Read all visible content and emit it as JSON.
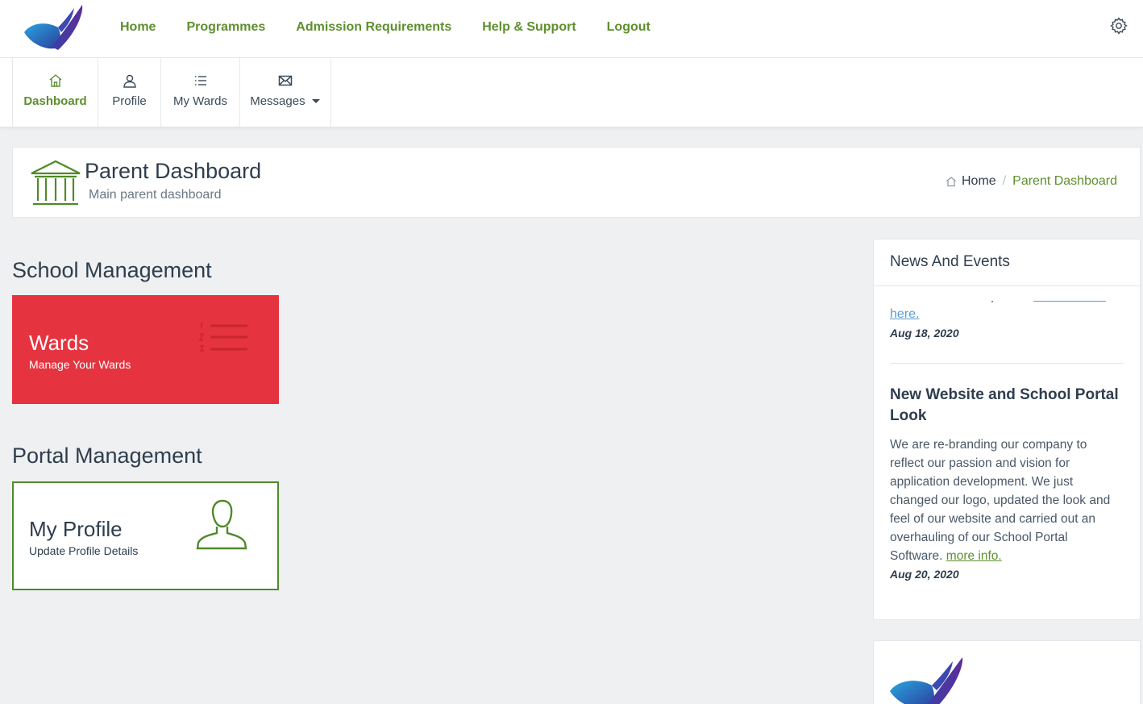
{
  "topnav": {
    "items": [
      "Home",
      "Programmes",
      "Admission Requirements",
      "Help & Support",
      "Logout"
    ]
  },
  "subnav": {
    "tabs": [
      {
        "label": "Dashboard",
        "icon": "home-icon",
        "active": true
      },
      {
        "label": "Profile",
        "icon": "user-icon",
        "active": false
      },
      {
        "label": "My Wards",
        "icon": "list-icon",
        "active": false
      },
      {
        "label": "Messages",
        "icon": "envelope-icon",
        "active": false
      }
    ]
  },
  "page": {
    "title": "Parent Dashboard",
    "subtitle": "Main parent dashboard",
    "breadcrumb": {
      "home": "Home",
      "separator": "/",
      "current": "Parent Dashboard"
    }
  },
  "sections": {
    "school": {
      "title": "School Management",
      "tile": {
        "title": "Wards",
        "subtitle": "Manage Your Wards",
        "icon": "list-numbered-icon",
        "color": "#e5333f"
      }
    },
    "portal": {
      "title": "Portal Management",
      "tile": {
        "title": "My Profile",
        "subtitle": "Update Profile Details",
        "icon": "user-outline-icon",
        "color": "#4f8a2a"
      }
    }
  },
  "news": {
    "heading": "News And Events",
    "item1": {
      "link_fragment": "here.",
      "date": "Aug 18, 2020"
    },
    "item2": {
      "title": "New Website and School Portal Look",
      "body": "We are re-branding our company to reflect our passion and vision for application development. We just changed our logo, updated the look and feel of our website and carried out an overhauling of our School Portal Software.",
      "link": "more info.",
      "date": "Aug 20, 2020"
    }
  },
  "colors": {
    "accent": "#5e8f2d",
    "danger": "#e5333f",
    "text": "#2f3e4e"
  }
}
